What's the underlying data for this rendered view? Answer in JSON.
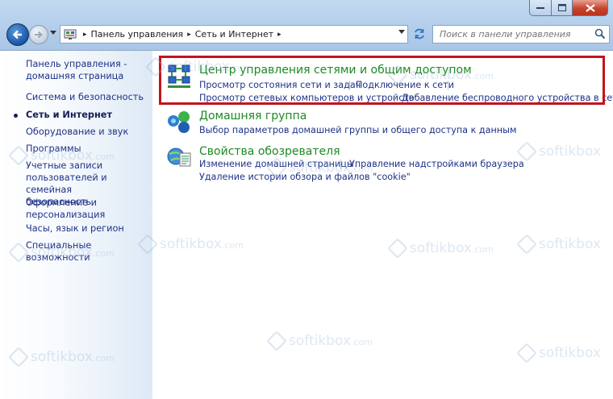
{
  "window": {
    "controls": {
      "minimize_icon": "minimize-icon",
      "maximize_icon": "maximize-icon",
      "close_icon": "close-icon"
    }
  },
  "address": {
    "crumbs": [
      "Панель управления",
      "Сеть и Интернет"
    ]
  },
  "search": {
    "placeholder": "Поиск в панели управления"
  },
  "sidebar": {
    "items": [
      {
        "label": "Панель управления - домашняя страница",
        "line1": "Панель управления -",
        "line2": "домашняя страница"
      },
      {
        "label": "Система и безопасность"
      },
      {
        "label": "Сеть и Интернет",
        "current": true
      },
      {
        "label": "Оборудование и звук"
      },
      {
        "label": "Программы"
      },
      {
        "label": "Учетные записи пользователей и семейная безопасность",
        "line1": "Учетные записи",
        "line2": "пользователей и семейная",
        "line3": "безопасность"
      },
      {
        "label": "Оформление и персонализация",
        "line1": "Оформление и",
        "line2": "персонализация"
      },
      {
        "label": "Часы, язык и регион"
      },
      {
        "label": "Специальные возможности"
      }
    ]
  },
  "categories": [
    {
      "title": "Центр управления сетями и общим доступом",
      "icon": "network-center-icon",
      "links": [
        "Просмотр состояния сети и задач",
        "Подключение к сети",
        "Просмотр сетевых компьютеров и устройств",
        "Добавление беспроводного устройства в сеть"
      ]
    },
    {
      "title": "Домашняя группа",
      "icon": "homegroup-icon",
      "links": [
        "Выбор параметров домашней группы и общего доступа к данным"
      ]
    },
    {
      "title": "Свойства обозревателя",
      "icon": "internet-options-icon",
      "links": [
        "Изменение домашней страницы",
        "Управление надстройками браузера",
        "Удаление истории обзора и файлов \"cookie\""
      ]
    }
  ],
  "watermark": {
    "text": "softikbox",
    "suffix": ".com"
  },
  "colors": {
    "title_green": "#1d8a23",
    "link_blue": "#1e3287",
    "highlight_red": "#c4141a"
  }
}
